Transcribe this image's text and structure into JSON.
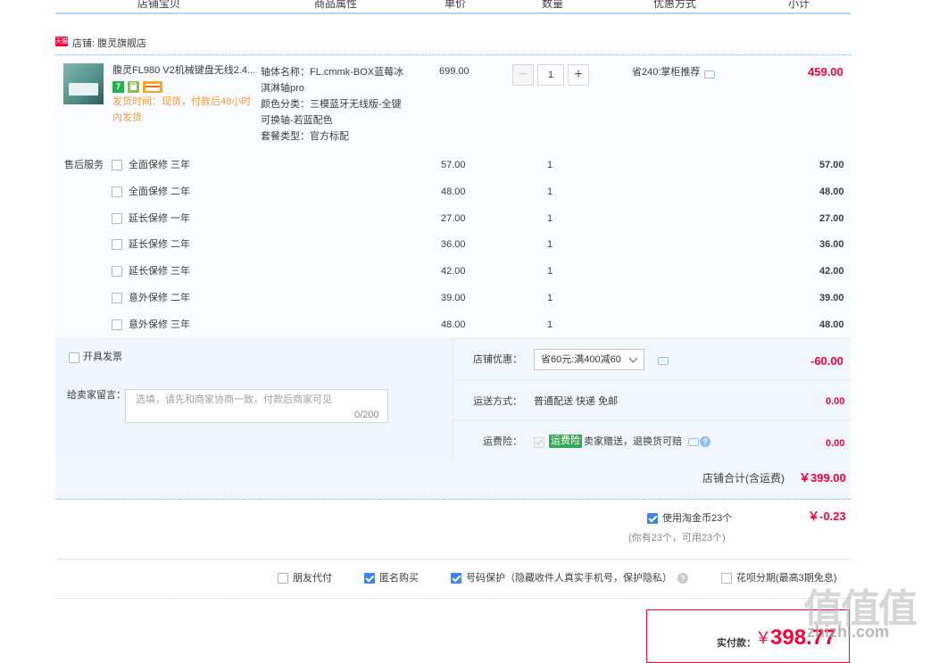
{
  "header": {
    "cols": [
      "店铺宝贝",
      "商品属性",
      "单价",
      "数量",
      "优惠方式",
      "小计"
    ]
  },
  "shop": {
    "badge": "天猫",
    "label": "店铺: 腹灵旗舰店"
  },
  "product": {
    "title": "腹灵FL980 V2机械键盘无线2.4...",
    "badges": [
      "7",
      "",
      ""
    ],
    "ship_line1": "发货时间：现货，付款后48小时",
    "ship_line2": "内发货",
    "attr1a": "轴体名称：FL.cmmk-BOX蓝莓冰",
    "attr1b": "淇淋轴pro",
    "attr2a": "颜色分类：三模蓝牙无线版-全键",
    "attr2b": "可换轴-若蓝配色",
    "attr3": "套餐类型：官方标配",
    "price": "699.00",
    "qty": "1",
    "promo": "省240:掌柜推荐",
    "subtotal": "459.00",
    "colors": {
      "accent": "#ff0036",
      "ship": "#f09a3c"
    }
  },
  "services": {
    "label": "售后服务",
    "items": [
      {
        "name": "全面保修 三年",
        "price": "57.00",
        "qty": "1",
        "subtotal": "57.00"
      },
      {
        "name": "全面保修 二年",
        "price": "48.00",
        "qty": "1",
        "subtotal": "48.00"
      },
      {
        "name": "延长保修 一年",
        "price": "27.00",
        "qty": "1",
        "subtotal": "27.00"
      },
      {
        "name": "延长保修 二年",
        "price": "36.00",
        "qty": "1",
        "subtotal": "36.00"
      },
      {
        "name": "延长保修 三年",
        "price": "42.00",
        "qty": "1",
        "subtotal": "42.00"
      },
      {
        "name": "意外保修 二年",
        "price": "39.00",
        "qty": "1",
        "subtotal": "39.00"
      },
      {
        "name": "意外保修 三年",
        "price": "48.00",
        "qty": "1",
        "subtotal": "48.00"
      }
    ]
  },
  "invoice": {
    "label": "开具发票"
  },
  "message": {
    "label": "给卖家留言：",
    "placeholder": "选填，请先和商家协商一致，付款后商家可见",
    "counter": "0/200"
  },
  "discount": {
    "label": "店铺优惠：",
    "selected": "省60元:满400减60",
    "amount": "-60.00"
  },
  "shipping": {
    "label": "运送方式：",
    "value": "普通配送 快递 免邮",
    "amount": "0.00"
  },
  "insurance": {
    "label": "运费险：",
    "tag": "运费险",
    "text": "卖家赠送，退换货可赔",
    "amount": "0.00"
  },
  "shop_total": {
    "label": "店铺合计(含运费)",
    "amount": "￥399.00"
  },
  "coins": {
    "label": "使用淘金币23个",
    "note": "(你有23个，可用23个)",
    "amount": "￥-0.23"
  },
  "options": {
    "friend_pay": "朋友代付",
    "anonymous": "匿名购买",
    "privacy": "号码保护（隐藏收件人真实手机号，保护隐私）",
    "installment": "花呗分期(最高3期免息)"
  },
  "payment": {
    "label": "实付款：",
    "currency": "￥",
    "amount": "398.77"
  },
  "watermark": {
    "logo": "值值值",
    "site": "zhizhi.com"
  }
}
